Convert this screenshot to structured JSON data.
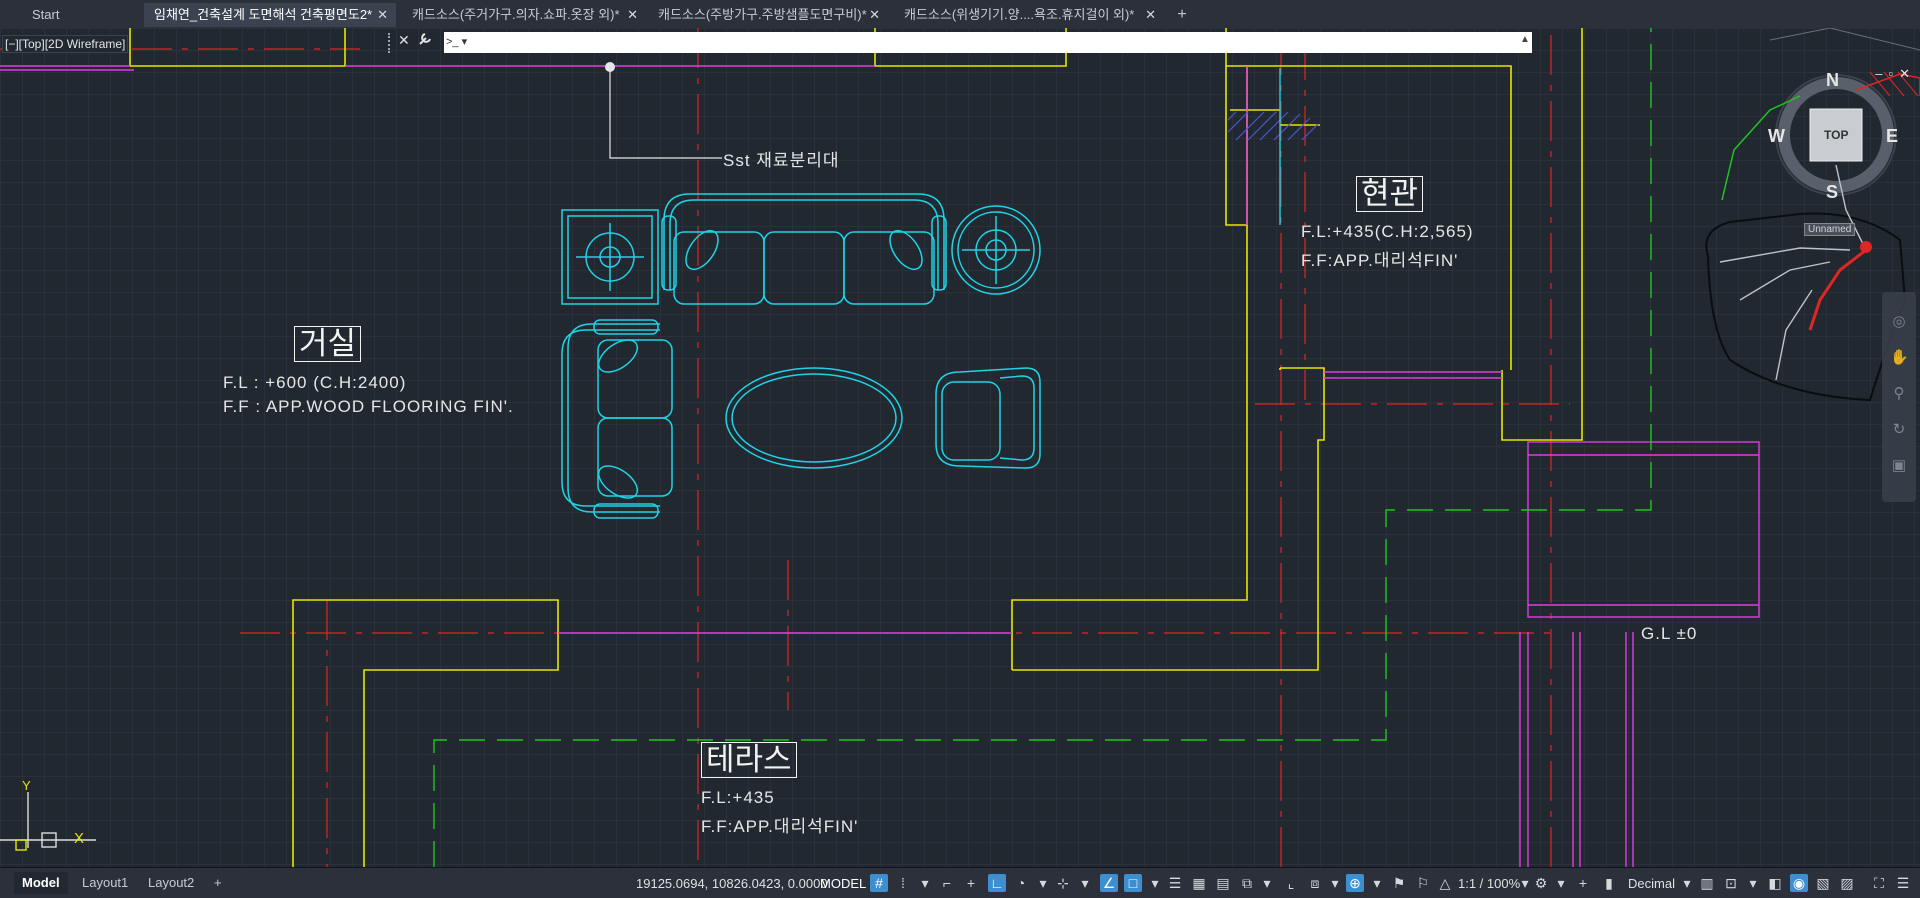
{
  "tabs": [
    {
      "label": "Start",
      "close": ""
    },
    {
      "label": "임채연_건축설계 도면해석 건축평면도2*",
      "close": "✕"
    },
    {
      "label": "캐드소스(주거가구.의자.쇼파.옷장 외)*",
      "close": "✕"
    },
    {
      "label": "캐드소스(주방가구.주방샘플도면구비)*",
      "close": "✕"
    },
    {
      "label": "캐드소스(위생기기.양....욕조.휴지걸이 외)*",
      "close": "✕"
    }
  ],
  "tab_add": "+",
  "viewport_label": "[−][Top][2D Wireframe]",
  "command": {
    "close": "✕",
    "settings_icon": "wrench-icon",
    "prompt": ">_ ▾",
    "value": "",
    "placeholder": "",
    "expand": "▲"
  },
  "window_controls": "–▫✕",
  "rooms": {
    "living": {
      "name": "거실",
      "fl": "F.L : +600 (C.H:2400)",
      "ff": "F.F : APP.WOOD FLOORING FIN'."
    },
    "entrance": {
      "name": "현관",
      "fl": "F.L:+435(C.H:2,565)",
      "ff": "F.F:APP.대리석FIN'"
    },
    "terrace": {
      "name": "테라스",
      "fl": "F.L:+435",
      "ff": "F.F:APP.대리석FIN'"
    }
  },
  "leader_note": "Sst 재료분리대",
  "gl_label": "G.L ±0",
  "viewcube": {
    "north": "N",
    "south": "S",
    "east": "E",
    "west": "W",
    "top": "TOP",
    "ucs": "Unnamed"
  },
  "ucs_icon": {
    "x": "X",
    "y": "Y"
  },
  "layout_tabs": [
    {
      "label": "Model",
      "active": true
    },
    {
      "label": "Layout1",
      "active": false
    },
    {
      "label": "Layout2",
      "active": false
    }
  ],
  "layout_add": "+",
  "status": {
    "coordinates": "19125.0694, 10826.0423, 0.0000",
    "space": "MODEL",
    "scale": "1:1 / 100%",
    "units": "Decimal"
  },
  "colors": {
    "yellow": "#e6e600",
    "cyan": "#1fd3e6",
    "magenta": "#e33be3",
    "red": "#e02525",
    "green": "#22c322",
    "background": "#212830"
  }
}
